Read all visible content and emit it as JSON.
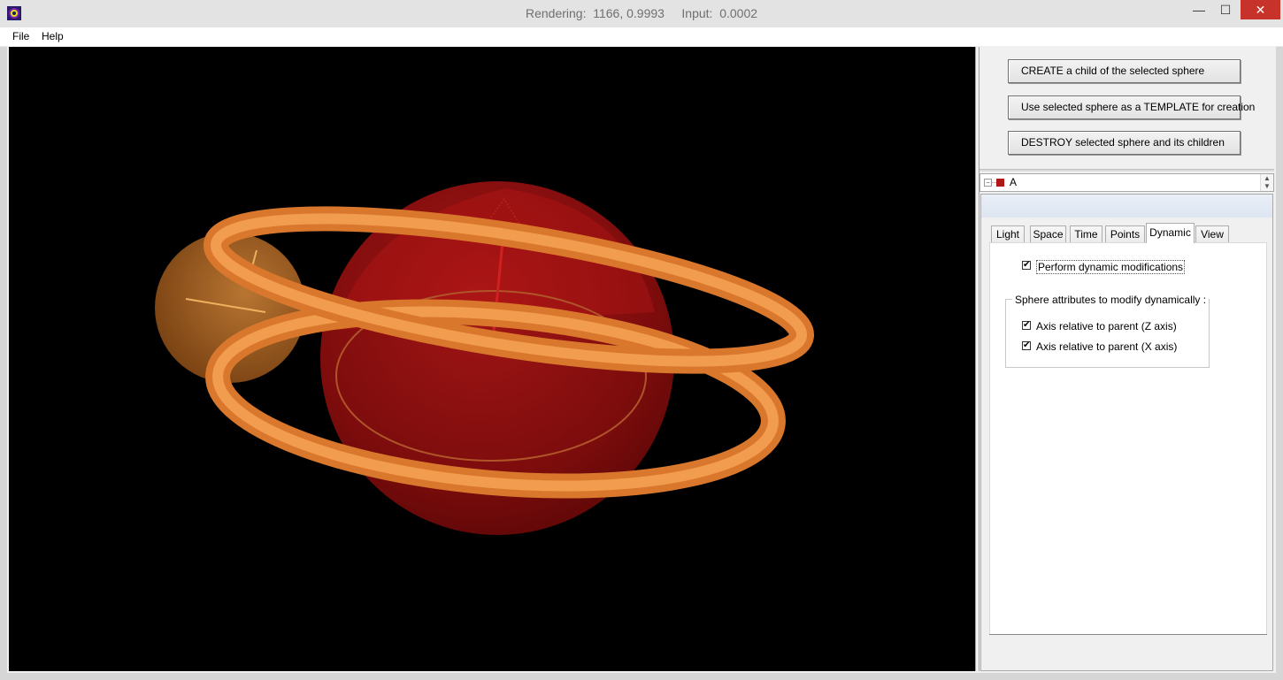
{
  "window": {
    "title": "Rendering:  1166, 0.9993     Input:  0.0002",
    "min_glyph": "—",
    "max_glyph": "☐",
    "close_glyph": "✕"
  },
  "menu": {
    "items": [
      {
        "label": "File"
      },
      {
        "label": "Help"
      }
    ]
  },
  "actions": {
    "create_label": "CREATE  a child of the selected sphere",
    "template_label": "Use selected sphere as a TEMPLATE for creation",
    "destroy_label": "DESTROY  selected sphere and its children"
  },
  "tree": {
    "expander": "−",
    "selected_label": "A",
    "selected_color": "#b01818"
  },
  "tabs": [
    {
      "label": "Light"
    },
    {
      "label": "Space"
    },
    {
      "label": "Time"
    },
    {
      "label": "Points"
    },
    {
      "label": "Dynamic",
      "active": true
    },
    {
      "label": "View"
    }
  ],
  "dynamic": {
    "perform_label": "Perform dynamic modifications",
    "perform_checked": true,
    "group_title": "Sphere attributes to modify dynamically :",
    "options": [
      {
        "label": "Axis relative to parent (Z axis)",
        "checked": true
      },
      {
        "label": "Axis relative to parent (X axis)",
        "checked": true
      }
    ]
  },
  "colors": {
    "sphere_main": "#a01010",
    "sphere_small": "#c0722a",
    "ring": "#f0923f",
    "close_button": "#c7322b"
  },
  "icons": {
    "app": "app-eye-icon",
    "check": "✔"
  }
}
